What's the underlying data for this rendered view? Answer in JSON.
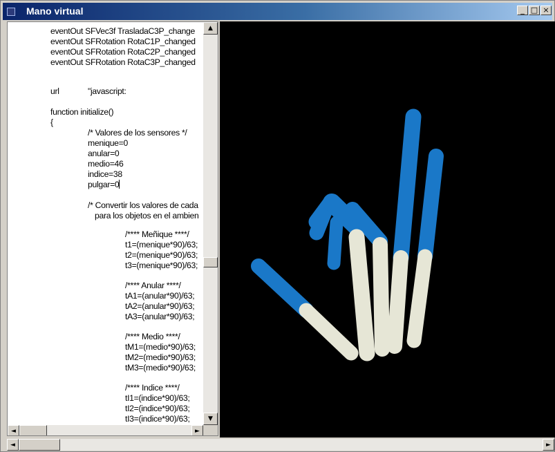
{
  "window": {
    "title": "Mano virtual",
    "controls": {
      "minimize": "_",
      "maximize": "□",
      "close": "×"
    }
  },
  "code_lines": [
    "eventOut SFVec3f TrasladaC3P_change",
    "eventOut SFRotation RotaC1P_changed",
    "eventOut SFRotation RotaC2P_changed",
    "eventOut SFRotation RotaC3P_changed",
    "url",
    "\"javascript:",
    "function initialize()",
    "{",
    "/* Valores de los sensores */",
    "menique=0",
    "anular=0",
    "medio=46",
    "indice=38",
    "pulgar=0",
    "/* Convertir los valores de cada",
    "para los objetos en el ambien",
    "/**** Meñique ****/",
    "t1=(menique*90)/63;",
    "t2=(menique*90)/63;",
    "t3=(menique*90)/63;",
    "/**** Anular ****/",
    "tA1=(anular*90)/63;",
    "tA2=(anular*90)/63;",
    "tA3=(anular*90)/63;",
    "/**** Medio ****/",
    "tM1=(medio*90)/63;",
    "tM2=(medio*90)/63;",
    "tM3=(medio*90)/63;",
    "/**** Indice ****/",
    "tI1=(indice*90)/63;",
    "tI2=(indice*90)/63;",
    "tI3=(indice*90)/63;"
  ],
  "scroll_arrows": {
    "up": "▲",
    "down": "▼",
    "left": "◄",
    "right": "►"
  },
  "scene": {
    "background": "#000000",
    "upper_segment_color": "#1a78c8",
    "lower_segment_color": "#e6e6d6"
  }
}
